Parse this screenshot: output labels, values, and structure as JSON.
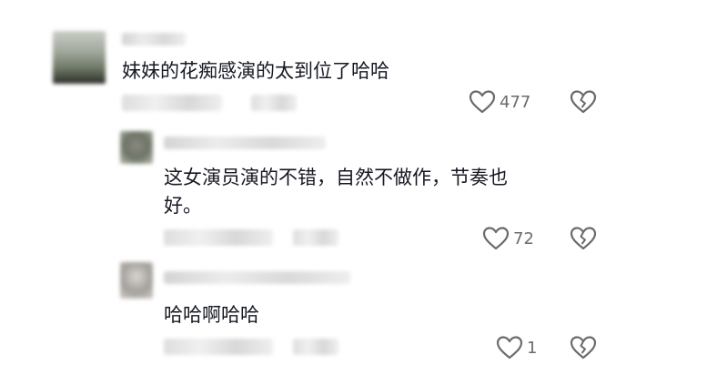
{
  "comments": [
    {
      "text": "妹妹的花痴感演的太到位了哈哈",
      "likes": "477",
      "icons": {
        "like": "heart-outline-icon",
        "dislike": "broken-heart-icon"
      }
    },
    {
      "text_line1": "这女演员演的不错，自然不做作，节奏也",
      "text_line2": "好。",
      "likes": "72",
      "icons": {
        "like": "heart-outline-icon",
        "dislike": "broken-heart-icon"
      }
    },
    {
      "text": "哈哈啊哈哈",
      "likes": "1",
      "icons": {
        "like": "heart-outline-icon",
        "dislike": "broken-heart-icon"
      }
    }
  ],
  "colors": {
    "text": "#161823",
    "icon": "#6b6b6b",
    "background": "#ffffff"
  }
}
